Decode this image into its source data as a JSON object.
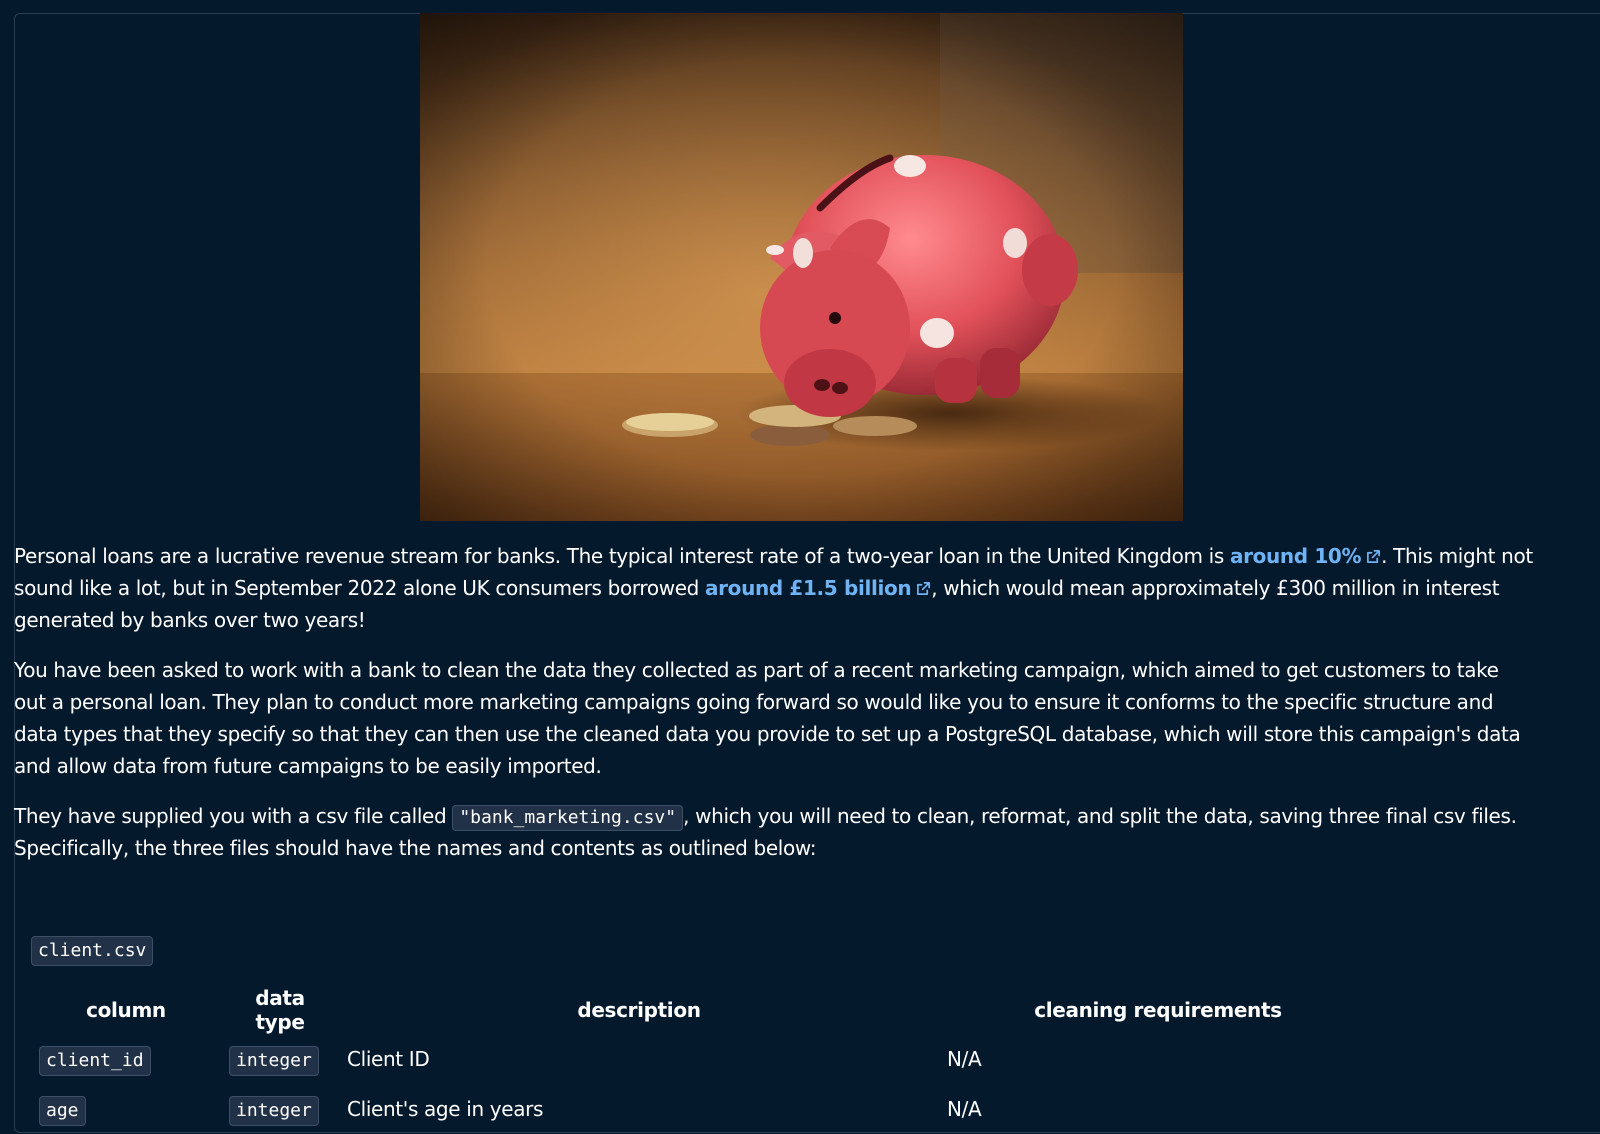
{
  "hero_image": {
    "icon": "piggy-bank-photo"
  },
  "intro": {
    "p1_l1_pre": "Personal loans are a lucrative revenue stream for banks. The typical interest rate of a two-year loan in the United Kingdom is ",
    "p1_link1": "around 10%",
    "p1_l1_post": ". This might not",
    "p1_l2_pre": "sound like a lot, but in September 2022 alone UK consumers borrowed ",
    "p1_link2": "around £1.5 billion",
    "p1_l2_post": ", which would mean approximately £300 million in interest",
    "p1_l3": "generated by banks over two years!",
    "p2_l1": "You have been asked to work with a bank to clean the data they collected as part of a recent marketing campaign, which aimed to get customers to take",
    "p2_l2": "out a personal loan. They plan to conduct more marketing campaigns going forward so would like you to ensure it conforms to the specific structure and",
    "p2_l3": "data types that they specify so that they can then use the cleaned data you provide to set up a PostgreSQL database, which will store this campaign's data",
    "p2_l4": "and allow data from future campaigns to be easily imported.",
    "p3_l1_pre": "They have supplied you with a csv file called ",
    "p3_code": "\"bank_marketing.csv\"",
    "p3_l1_post": ", which you will need to clean, reformat, and split the data, saving three final csv files.",
    "p3_l2": "Specifically, the three files should have the names and contents as outlined below:"
  },
  "file_title": "client.csv",
  "table": {
    "headers": {
      "column": "column",
      "data_type": "data type",
      "description": "description",
      "cleaning": "cleaning requirements"
    },
    "rows": [
      {
        "column": "client_id",
        "data_type": "integer",
        "description": "Client ID",
        "cleaning": "N/A"
      },
      {
        "column": "age",
        "data_type": "integer",
        "description": "Client's age in years",
        "cleaning": "N/A"
      }
    ]
  },
  "colors": {
    "background": "#05192d",
    "link": "#6fb3f4",
    "code_bg": "#213147",
    "panel_border": "#2b3d52"
  }
}
